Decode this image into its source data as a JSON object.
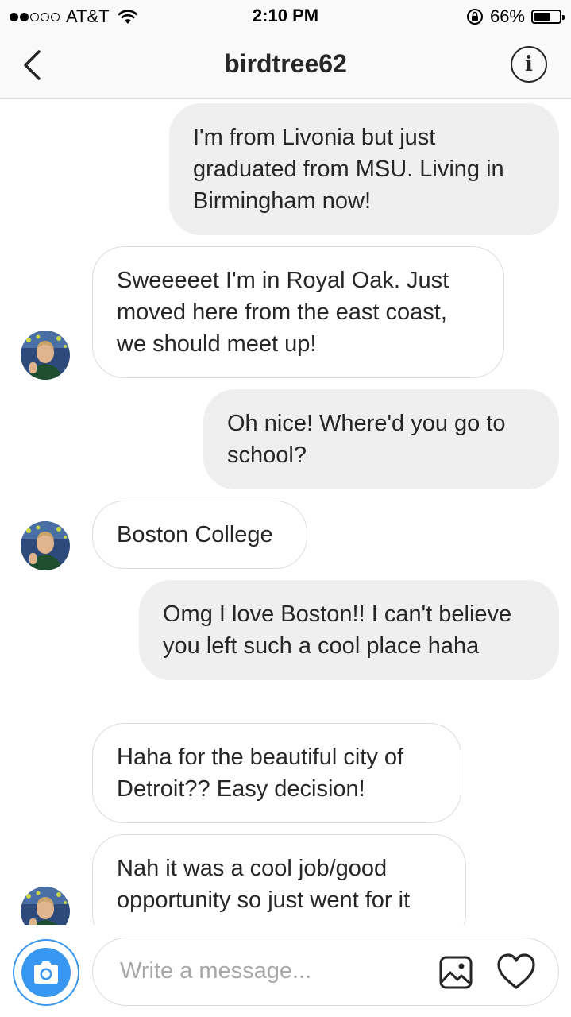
{
  "status_bar": {
    "signal_bars_filled": 2,
    "signal_bars_total": 5,
    "carrier": "AT&T",
    "time": "2:10 PM",
    "battery_percent": "66%",
    "battery_level": 0.66
  },
  "header": {
    "username": "birdtree62"
  },
  "messages": [
    {
      "direction": "sent",
      "text": "I'm from Livonia but just graduated from MSU. Living in Birmingham now!"
    },
    {
      "direction": "received",
      "text": "Sweeeeet I'm in Royal Oak. Just moved here from the east coast, we should meet up!"
    },
    {
      "direction": "sent",
      "text": "Oh nice! Where'd you go to school?"
    },
    {
      "direction": "received",
      "text": "Boston College"
    },
    {
      "direction": "sent",
      "text": "Omg I love Boston!! I can't believe you left such a cool place haha"
    },
    {
      "direction": "received",
      "text": "Haha for the beautiful city of Detroit?? Easy decision!"
    },
    {
      "direction": "received",
      "text": "Nah it was a cool job/good opportunity so just went for it"
    }
  ],
  "composer": {
    "placeholder": "Write a message..."
  },
  "icons": {
    "back": "chevron-left-icon",
    "info": "info-icon",
    "camera": "camera-icon",
    "gallery": "image-icon",
    "like": "heart-icon",
    "wifi": "wifi-icon",
    "lock": "orientation-lock-icon"
  },
  "colors": {
    "accent": "#3897f0",
    "sent_bubble": "#efefef",
    "received_border": "#dbdbdb"
  }
}
